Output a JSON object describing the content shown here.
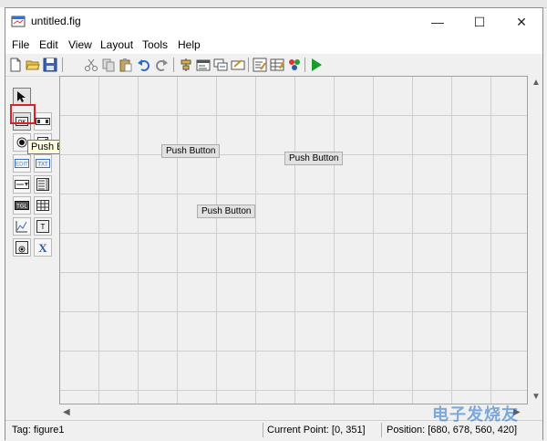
{
  "window": {
    "title": "untitled.fig"
  },
  "window_controls": {
    "minimize": "—",
    "maximize": "☐",
    "close": "✕"
  },
  "menu": [
    "File",
    "Edit",
    "View",
    "Layout",
    "Tools",
    "Help"
  ],
  "toolbar_icons": [
    "new-icon",
    "open-icon",
    "save-icon",
    "cut-icon",
    "copy-icon",
    "paste-icon",
    "undo-icon",
    "redo-icon",
    "align-icon",
    "menu-editor-icon",
    "tab-order-icon",
    "toolbar-editor-icon",
    "editor-icon",
    "property-inspector-icon",
    "object-browser-icon",
    "run-icon"
  ],
  "palette": {
    "selected_tool": "push-button",
    "tooltip": "Push Button",
    "tools": [
      "select",
      "push-button",
      "slider",
      "radio-button",
      "check-box",
      "edit-text",
      "static-text",
      "popup-menu",
      "listbox",
      "toggle-button",
      "table",
      "axes",
      "panel",
      "button-group",
      "activex"
    ]
  },
  "canvas": {
    "buttons": [
      {
        "label": "Push Button"
      },
      {
        "label": "Push Button"
      },
      {
        "label": "Push Button"
      }
    ]
  },
  "status": {
    "tag": "Tag: figure1",
    "current_point": "Current Point:  [0, 351]",
    "position": "Position: [680, 678, 560, 420]"
  },
  "watermark": "电子发烧友",
  "colors": {
    "highlight": "#d9232a",
    "run": "#1a9c2a"
  }
}
